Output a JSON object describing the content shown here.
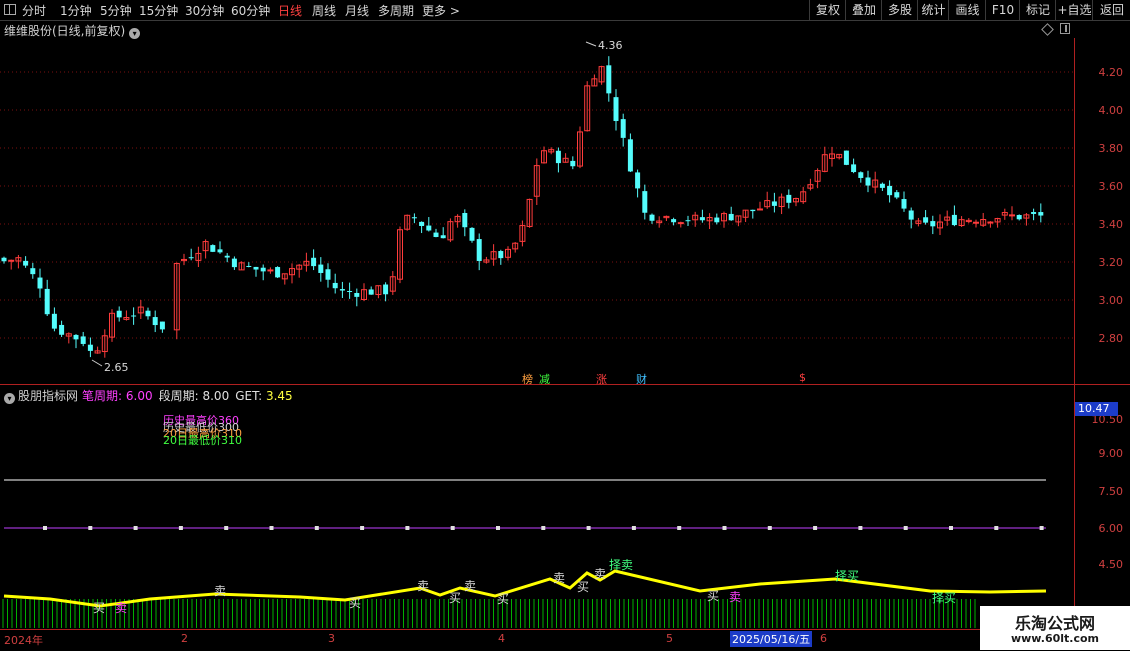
{
  "toolbar": {
    "periods": [
      "分时",
      "1分钟",
      "5分钟",
      "15分钟",
      "30分钟",
      "60分钟",
      "日线",
      "周线",
      "月线",
      "多周期",
      "更多 >"
    ],
    "active_period": "日线",
    "right_buttons": [
      "复权",
      "叠加",
      "多股",
      "统计",
      "画线",
      "F10",
      "标记",
      "+自选",
      "返回"
    ]
  },
  "main_chart": {
    "title": "维维股份(日线,前复权)",
    "price_ticks": [
      "4.20",
      "4.00",
      "3.80",
      "3.60",
      "3.40",
      "3.20",
      "3.00",
      "2.80"
    ],
    "high_label": "4.36",
    "low_label": "2.65",
    "markers": [
      {
        "text": "榜",
        "color": "#ffa040"
      },
      {
        "text": "减",
        "color": "#40ff40"
      },
      {
        "text": "涨",
        "color": "#ff4040"
      },
      {
        "text": "财",
        "color": "#40c0ff"
      },
      {
        "text": "$",
        "color": "#ff4040"
      }
    ],
    "colors": {
      "up": "#ff3c3c",
      "down": "#54fcfc",
      "grid": "#7a1010"
    }
  },
  "indicator": {
    "name": "股朋指标网",
    "bi_label": "笔周期:",
    "bi_value": "6.00",
    "duan_label": "段周期:",
    "duan_value": "8.00",
    "get_label": "GET:",
    "get_value": "3.45",
    "current_value": "10.47",
    "ticks": [
      "10.50",
      "9.00",
      "7.50",
      "6.00",
      "4.50"
    ],
    "stats": [
      {
        "text": "历史最高价360",
        "color": "#ff40ff"
      },
      {
        "text": "历史最低价300",
        "color": "#d0d0d0"
      },
      {
        "text": "20日最高价310",
        "color": "#ffa040"
      },
      {
        "text": "20日最低价310",
        "color": "#40ff40"
      }
    ],
    "signals": {
      "buy": "买",
      "sell": "卖",
      "ze_buy": "择买",
      "ze_sell": "择卖"
    },
    "colors": {
      "line": "#ffff00",
      "hist": "#00b000",
      "white_line": "#ffffff",
      "purple_line": "#c040ff"
    }
  },
  "dates": [
    "2024年",
    "2",
    "3",
    "4",
    "5",
    "6"
  ],
  "selected_date": "2025/05/16/五",
  "watermark": {
    "title": "乐淘公式网",
    "url": "www.60lt.com"
  }
}
